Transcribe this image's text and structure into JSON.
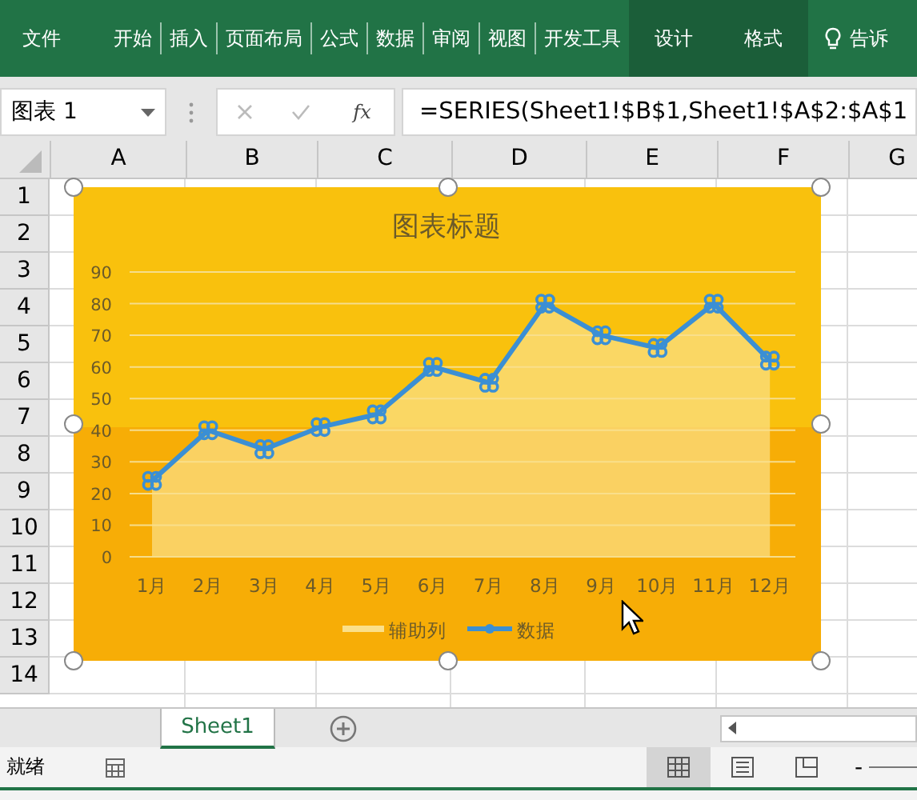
{
  "ribbon": {
    "tabs": [
      {
        "label": "文件",
        "kind": "file"
      },
      {
        "label": "开始",
        "kind": "normal"
      },
      {
        "label": "插入",
        "kind": "normal"
      },
      {
        "label": "页面布局",
        "kind": "normal"
      },
      {
        "label": "公式",
        "kind": "normal"
      },
      {
        "label": "数据",
        "kind": "normal"
      },
      {
        "label": "审阅",
        "kind": "normal"
      },
      {
        "label": "视图",
        "kind": "normal"
      },
      {
        "label": "开发工具",
        "kind": "normal"
      },
      {
        "label": "设计",
        "kind": "contextual"
      },
      {
        "label": "格式",
        "kind": "contextual"
      }
    ],
    "tell_me": "告诉"
  },
  "formula_bar": {
    "name_box": "图表 1",
    "fx": "fx",
    "formula": "=SERIES(Sheet1!$B$1,Sheet1!$A$2:$A$1"
  },
  "grid": {
    "columns": [
      "A",
      "B",
      "C",
      "D",
      "E",
      "F",
      "G"
    ],
    "rows": [
      "1",
      "2",
      "3",
      "4",
      "5",
      "6",
      "7",
      "8",
      "9",
      "10",
      "11",
      "12",
      "13",
      "14"
    ]
  },
  "chart": {
    "chart_data": {
      "type": "line",
      "title": "图表标题",
      "categories": [
        "1月",
        "2月",
        "3月",
        "4月",
        "5月",
        "6月",
        "7月",
        "8月",
        "9月",
        "10月",
        "11月",
        "12月"
      ],
      "series": [
        {
          "name": "辅助列",
          "type": "area",
          "color": "#fbe08a",
          "values": [
            24,
            40,
            34,
            41,
            45,
            60,
            55,
            80,
            70,
            66,
            80,
            62
          ]
        },
        {
          "name": "数据",
          "type": "line",
          "color": "#3b8fd4",
          "values": [
            24,
            40,
            34,
            41,
            45,
            60,
            55,
            80,
            70,
            66,
            80,
            62
          ]
        }
      ],
      "ylim": [
        0,
        90
      ],
      "grid": true,
      "legend": true,
      "yticks": [
        0,
        10,
        20,
        30,
        40,
        50,
        60,
        70,
        80,
        90
      ]
    }
  },
  "sheet_tabs": [
    {
      "label": "Sheet1",
      "selected": true
    }
  ],
  "status_bar": {
    "text": "就绪",
    "views": [
      {
        "kind": "normal",
        "selected": true
      },
      {
        "kind": "page-layout",
        "selected": false
      },
      {
        "kind": "page-break",
        "selected": false
      }
    ],
    "zoom_out": "-"
  }
}
